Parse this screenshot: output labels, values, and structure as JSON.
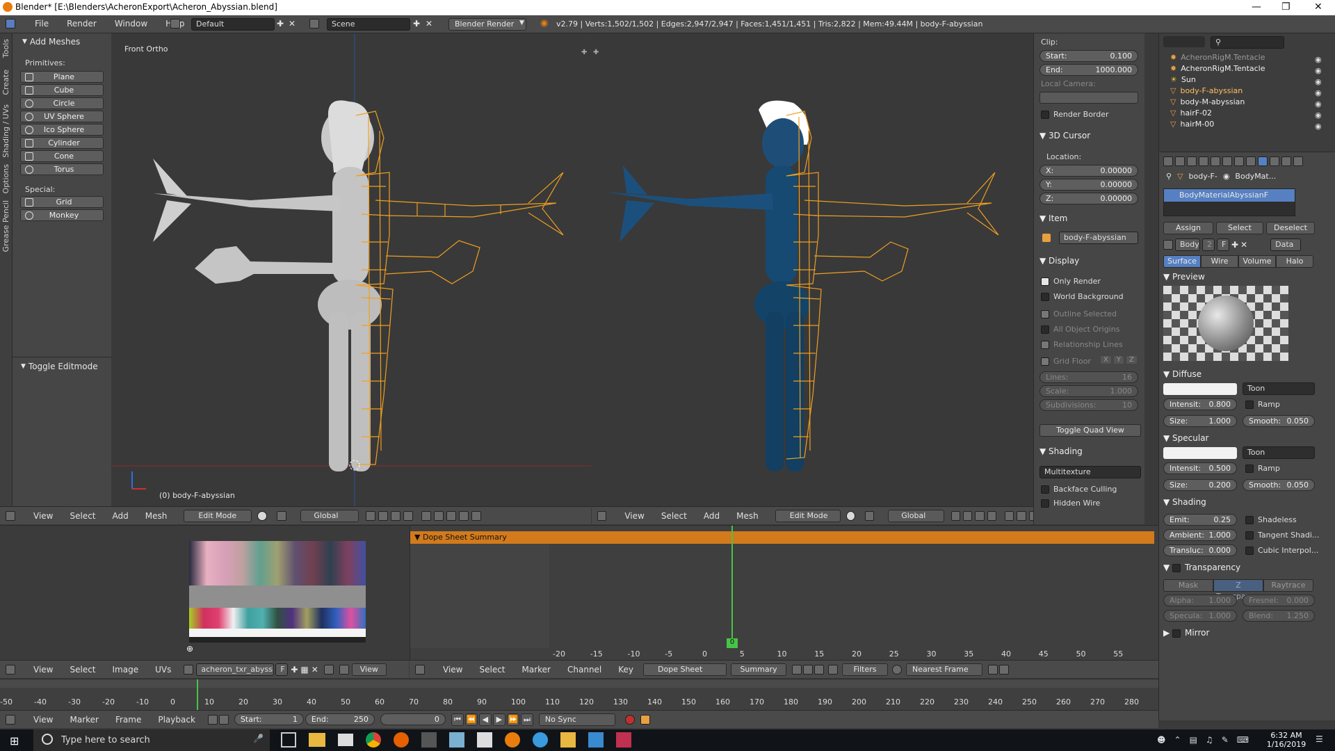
{
  "window": {
    "title": "Blender* [E:\\Blenders\\AcheronExport\\Acheron_Abyssian.blend]"
  },
  "infobar": {
    "menus": [
      "File",
      "Render",
      "Window",
      "Help"
    ],
    "screen_layout": "Default",
    "scene": "Scene",
    "render_engine": "Blender Render",
    "stats": "v2.79 | Verts:1,502/1,502 | Edges:2,947/2,947 | Faces:1,451/1,451 | Tris:2,822 | Mem:49.44M | body-F-abyssian"
  },
  "left_viewport": {
    "view_label": "Front Ortho",
    "object_label": "(0) body-F-abyssian",
    "side_tabs": [
      "Tools",
      "Create",
      "Shading / UVs",
      "Options",
      "Grease Pencil"
    ],
    "add_meshes": {
      "title": "Add Meshes",
      "primitives_label": "Primitives:",
      "primitives": [
        "Plane",
        "Cube",
        "Circle",
        "UV Sphere",
        "Ico Sphere",
        "Cylinder",
        "Cone",
        "Torus"
      ],
      "special_label": "Special:",
      "special": [
        "Grid",
        "Monkey"
      ]
    },
    "operator_panel": "Toggle Editmode",
    "header": {
      "menus": [
        "View",
        "Select",
        "Add",
        "Mesh"
      ],
      "mode": "Edit Mode",
      "orientation": "Global"
    }
  },
  "right_viewport": {
    "header": {
      "menus": [
        "View",
        "Select",
        "Add",
        "Mesh"
      ],
      "mode": "Edit Mode",
      "orientation": "Global"
    }
  },
  "npanel": {
    "clip_label": "Clip:",
    "clip_start_label": "Start:",
    "clip_start": "0.100",
    "clip_end_label": "End:",
    "clip_end": "1000.000",
    "local_camera_label": "Local Camera:",
    "render_border": "Render Border",
    "cursor_section": "3D Cursor",
    "location_label": "Location:",
    "x_label": "X:",
    "x": "0.00000",
    "y_label": "Y:",
    "y": "0.00000",
    "z_label": "Z:",
    "z": "0.00000",
    "item_section": "Item",
    "item_name": "body-F-abyssian",
    "display_section": "Display",
    "only_render": "Only Render",
    "world_background": "World Background",
    "outline_selected": "Outline Selected",
    "all_object_origins": "All Object Origins",
    "relationship_lines": "Relationship Lines",
    "grid_floor": "Grid Floor",
    "grid_axes": [
      "X",
      "Y",
      "Z"
    ],
    "lines_label": "Lines:",
    "lines": "16",
    "scale_label": "Scale:",
    "scale": "1.000",
    "subdivisions_label": "Subdivisions:",
    "subdivisions": "10",
    "toggle_quad": "Toggle Quad View",
    "shading_section": "Shading",
    "shading_mode": "Multitexture",
    "backface_culling": "Backface Culling",
    "hidden_wire": "Hidden Wire"
  },
  "outliner": {
    "items": [
      {
        "name": "AcheronRigM.Tentacle"
      },
      {
        "name": "AcheronRigM.Tentacle"
      },
      {
        "name": "Sun"
      },
      {
        "name": "body-F-abyssian"
      },
      {
        "name": "body-M-abyssian"
      },
      {
        "name": "hairF-02"
      },
      {
        "name": "hairM-00"
      }
    ]
  },
  "properties": {
    "breadcrumb_object": "body-F-",
    "breadcrumb_material": "BodyMat...",
    "material_slot": "BodyMaterialAbyssianF",
    "assign": "Assign",
    "select": "Select",
    "deselect": "Deselect",
    "material_name": "Body",
    "users": "2",
    "fake_user": "F",
    "data_label": "Data",
    "tabs": [
      "Surface",
      "Wire",
      "Volume",
      "Halo"
    ],
    "preview_section": "Preview",
    "diffuse_section": "Diffuse",
    "diffuse_shader": "Toon",
    "diffuse_intensity_label": "Intensit:",
    "diffuse_intensity": "0.800",
    "diffuse_ramp": "Ramp",
    "diffuse_size_label": "Size:",
    "diffuse_size": "1.000",
    "diffuse_smooth_label": "Smooth:",
    "diffuse_smooth": "0.050",
    "specular_section": "Specular",
    "specular_shader": "Toon",
    "spec_intensity_label": "Intensit:",
    "spec_intensity": "0.500",
    "spec_ramp": "Ramp",
    "spec_size_label": "Size:",
    "spec_size": "0.200",
    "spec_smooth_label": "Smooth:",
    "spec_smooth": "0.050",
    "shading_section": "Shading",
    "emit_label": "Emit:",
    "emit": "0.25",
    "shadeless": "Shadeless",
    "ambient_label": "Ambient:",
    "ambient": "1.000",
    "tangent_shading": "Tangent Shadi...",
    "transluc_label": "Transluc:",
    "transluc": "0.000",
    "cubic_interp": "Cubic Interpol...",
    "transparency_section": "Transparency",
    "transp_tabs": [
      "Mask",
      "Z Transpare...",
      "Raytrace"
    ],
    "alpha_label": "Alpha:",
    "alpha": "1.000",
    "fresnel_label": "Fresnel:",
    "fresnel": "0.000",
    "specula_label": "Specula:",
    "specula": "1.000",
    "blend_label": "Blend:",
    "blend": "1.250",
    "mirror_section": "Mirror"
  },
  "image_editor": {
    "menus": [
      "View",
      "Select",
      "Image",
      "UVs"
    ],
    "image_name": "acheron_txr_abyssi...",
    "fake_user": "F",
    "view": "View"
  },
  "dopesheet": {
    "summary_label": "Dope Sheet Summary",
    "current_frame_badge": "0",
    "ruler": [
      "-20",
      "-15",
      "-10",
      "-5",
      "0",
      "5",
      "10",
      "15",
      "20",
      "25",
      "30",
      "35",
      "40",
      "45",
      "50",
      "55"
    ],
    "menus": [
      "View",
      "Select",
      "Marker",
      "Channel",
      "Key"
    ],
    "mode": "Dope Sheet",
    "summary_btn": "Summary",
    "filters": "Filters",
    "snap": "Nearest Frame"
  },
  "timeline": {
    "ruler": [
      "-50",
      "-40",
      "-30",
      "-20",
      "-10",
      "0",
      "10",
      "20",
      "30",
      "40",
      "50",
      "60",
      "70",
      "80",
      "90",
      "100",
      "110",
      "120",
      "130",
      "140",
      "150",
      "160",
      "170",
      "180",
      "190",
      "200",
      "210",
      "220",
      "230",
      "240",
      "250",
      "260",
      "270",
      "280"
    ],
    "menus": [
      "View",
      "Marker",
      "Frame",
      "Playback"
    ],
    "start_label": "Start:",
    "start": "1",
    "end_label": "End:",
    "end": "250",
    "current": "0",
    "sync": "No Sync"
  },
  "taskbar": {
    "search_placeholder": "Type here to search",
    "time": "6:32 AM",
    "date": "1/16/2019"
  },
  "colors": {
    "accent_blue": "#5680c2",
    "wire_orange": "#f0a020",
    "dopesheet_orange": "#d27a1c",
    "frame_green": "#47c447"
  }
}
